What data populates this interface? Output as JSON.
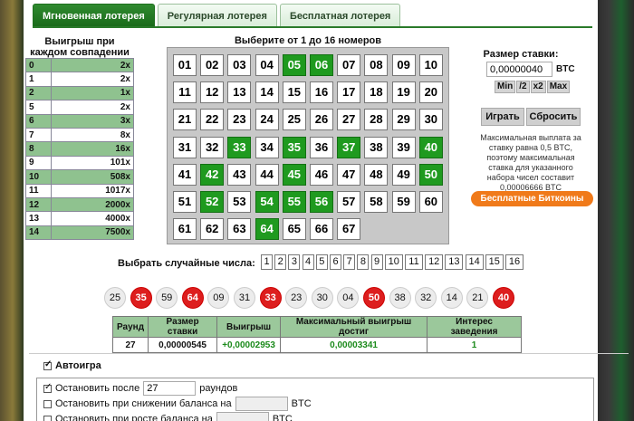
{
  "tabs": [
    "Мгновенная лотерея",
    "Регулярная лотерея",
    "Бесплатная лотерея"
  ],
  "payout": {
    "title_line1": "Выигрыш при",
    "title_line2": "каждом совпадении",
    "rows": [
      {
        "n": "0",
        "m": "2x"
      },
      {
        "n": "1",
        "m": "2x"
      },
      {
        "n": "2",
        "m": "1x"
      },
      {
        "n": "5",
        "m": "2x"
      },
      {
        "n": "6",
        "m": "3x"
      },
      {
        "n": "7",
        "m": "8x"
      },
      {
        "n": "8",
        "m": "16x"
      },
      {
        "n": "9",
        "m": "101x"
      },
      {
        "n": "10",
        "m": "508x"
      },
      {
        "n": "11",
        "m": "1017x"
      },
      {
        "n": "12",
        "m": "2000x"
      },
      {
        "n": "13",
        "m": "4000x"
      },
      {
        "n": "14",
        "m": "7500x"
      }
    ]
  },
  "grid": {
    "title": "Выберите от 1 до 16 номеров",
    "numbers": [
      "01",
      "02",
      "03",
      "04",
      "05",
      "06",
      "07",
      "08",
      "09",
      "10",
      "11",
      "12",
      "13",
      "14",
      "15",
      "16",
      "17",
      "18",
      "19",
      "20",
      "21",
      "22",
      "23",
      "24",
      "25",
      "26",
      "27",
      "28",
      "29",
      "30",
      "31",
      "32",
      "33",
      "34",
      "35",
      "36",
      "37",
      "38",
      "39",
      "40",
      "41",
      "42",
      "43",
      "44",
      "45",
      "46",
      "47",
      "48",
      "49",
      "50",
      "51",
      "52",
      "53",
      "54",
      "55",
      "56",
      "57",
      "58",
      "59",
      "60",
      "61",
      "62",
      "63",
      "64",
      "65",
      "66",
      "67"
    ],
    "selected": [
      "05",
      "06",
      "33",
      "35",
      "37",
      "40",
      "42",
      "45",
      "50",
      "52",
      "54",
      "55",
      "56",
      "64"
    ]
  },
  "bet": {
    "label": "Размер ставки:",
    "value": "0,00000040",
    "unit": "BTC",
    "multipliers": [
      "Min",
      "/2",
      "x2",
      "Max"
    ],
    "play": "Играть",
    "reset": "Сбросить",
    "info": "Максимальная выплата за ставку равна 0,5 BTC, поэтому максимальная ставка для указанного набора чисел составит 0,00006666 BTC",
    "free_button": "Бесплатные Биткоины"
  },
  "random": {
    "label": "Выбрать случайные числа:",
    "options": [
      "1",
      "2",
      "3",
      "4",
      "5",
      "6",
      "7",
      "8",
      "9",
      "10",
      "11",
      "12",
      "13",
      "14",
      "15",
      "16"
    ]
  },
  "results": {
    "numbers": [
      "25",
      "35",
      "59",
      "64",
      "09",
      "31",
      "33",
      "23",
      "30",
      "04",
      "50",
      "38",
      "32",
      "14",
      "21",
      "40"
    ],
    "hits": [
      "35",
      "64",
      "33",
      "50",
      "40"
    ]
  },
  "round_table": {
    "headers": [
      "Раунд",
      "Размер ставки",
      "Выигрыш",
      "Максимальный выигрыш достиг",
      "Интерес заведения"
    ],
    "values": [
      "27",
      "0,00000545",
      "+0,00002953",
      "0,00003341",
      "1"
    ]
  },
  "autoplay": {
    "title": "Автоигра",
    "stop_after_label": "Остановить после",
    "stop_after_value": "27",
    "stop_after_unit": "раундов",
    "stop_decrease_label": "Остановить при снижении баланса на",
    "stop_increase_label": "Остановить при росте баланса на",
    "unit": "BTC"
  },
  "colors": {
    "accent": "#2f8a2f",
    "selected": "#1f9a1f",
    "hit": "#dd1e1e",
    "free_button": "#f07a1a"
  }
}
